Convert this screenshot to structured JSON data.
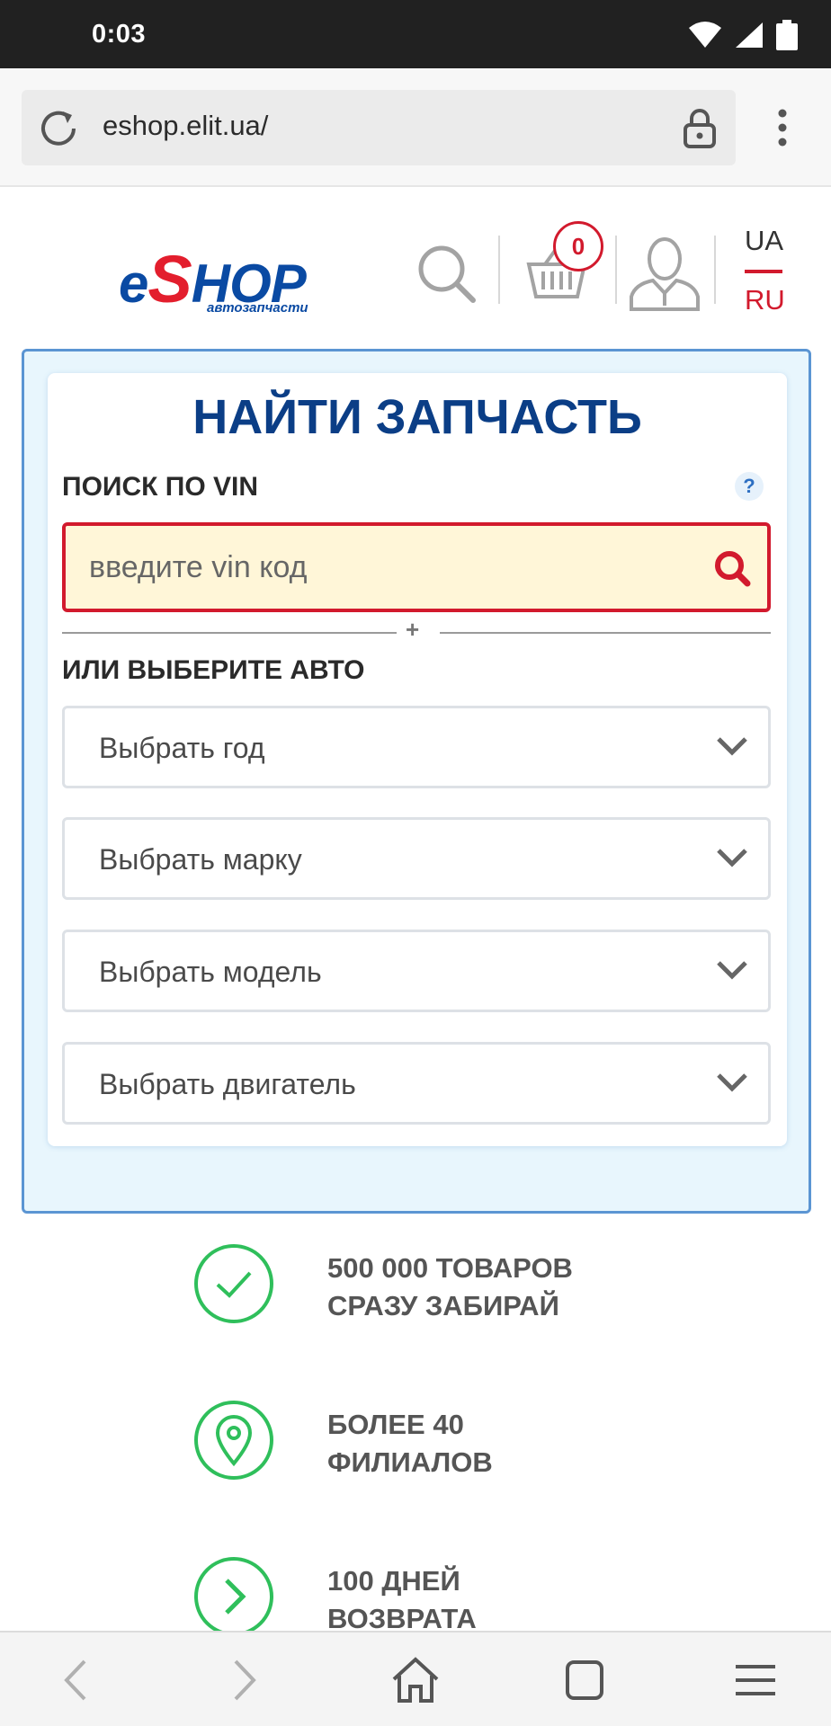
{
  "status_bar": {
    "time": "0:03"
  },
  "browser": {
    "url": "eshop.elit.ua/"
  },
  "header": {
    "logo_main": "eSHOP",
    "logo_e": "e",
    "logo_s": "S",
    "logo_hop": "HOP",
    "logo_sub": "автозапчасти",
    "cart_count": "0",
    "lang_ua": "UA",
    "lang_ru": "RU",
    "accent_color": "#d21a2d",
    "brand_color": "#0b3e86"
  },
  "search_panel": {
    "title": "НАЙТИ ЗАПЧАСТЬ",
    "vin_label": "ПОИСК ПО VIN",
    "help": "?",
    "vin_placeholder": "введите vin код",
    "separator": "+",
    "auto_label": "ИЛИ ВЫБЕРИТЕ АВТО",
    "selects": [
      {
        "label": "Выбрать год"
      },
      {
        "label": "Выбрать марку"
      },
      {
        "label": "Выбрать модель"
      },
      {
        "label": "Выбрать двигатель"
      }
    ]
  },
  "features": [
    {
      "icon": "check-icon",
      "line1": "500 000 ТОВАРОВ",
      "line2": "СРАЗУ ЗАБИРАЙ"
    },
    {
      "icon": "location-pin-icon",
      "line1": "БОЛЕЕ 40",
      "line2": "ФИЛИАЛОВ"
    },
    {
      "icon": "chevron-right-circle-icon",
      "line1": "100 ДНЕЙ",
      "line2": "ВОЗВРАТА"
    }
  ]
}
